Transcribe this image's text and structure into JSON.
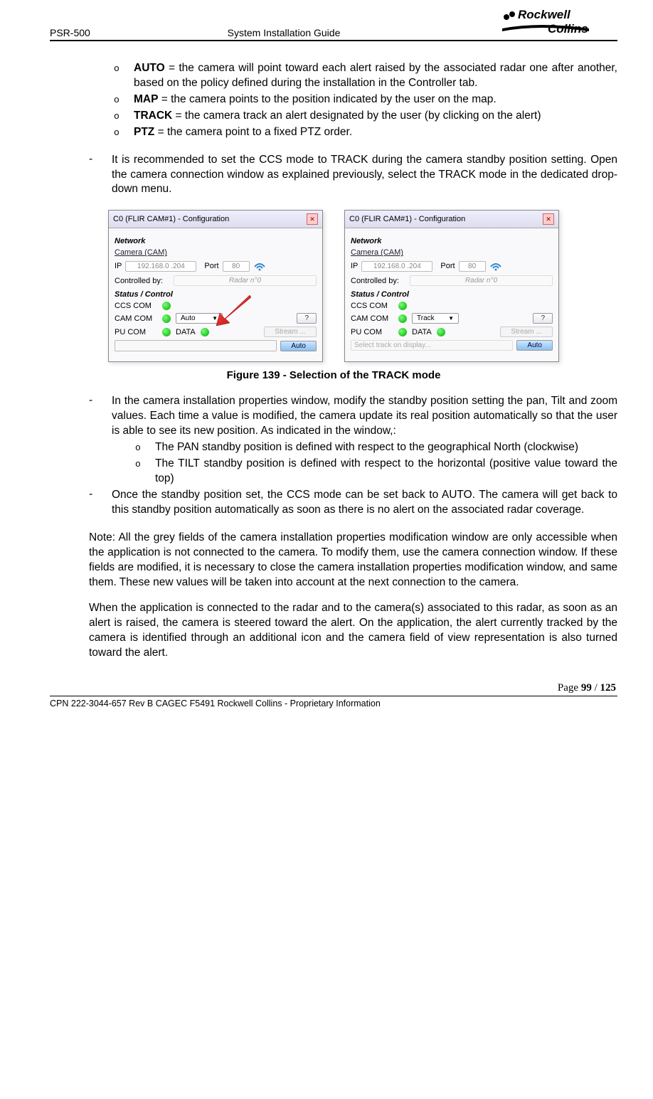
{
  "header": {
    "left": "PSR-500",
    "center": "System Installation Guide",
    "logo_top": "Rockwell",
    "logo_bottom": "Collins"
  },
  "definitions": [
    {
      "term": "AUTO",
      "text": " = the camera will point toward each alert raised by the associated radar one after another, based on the policy defined during the installation in the Controller tab."
    },
    {
      "term": " MAP",
      "text": " = the camera points to the position indicated by the user on the map."
    },
    {
      "term": "TRACK",
      "text": " = the camera track an alert designated by the user (by clicking on the alert)"
    },
    {
      "term": " PTZ",
      "text": " = the camera point to a fixed PTZ order."
    }
  ],
  "dash1": "It is recommended to set the CCS mode to TRACK during the camera standby position setting. Open the camera connection window as explained previously, select the TRACK mode in the dedicated drop-down menu.",
  "panel": {
    "title": "C0 (FLIR CAM#1) - Configuration",
    "network": "Network",
    "camera_link": "Camera (CAM)",
    "ip_label": "IP",
    "ip_value": "192.168.0 .204",
    "port_label": "Port",
    "port_value": "80",
    "controlled_by": "Controlled by:",
    "radar": "Radar n°0",
    "status": "Status / Control",
    "ccs": "CCS COM",
    "cam": "CAM COM",
    "pu": "PU COM",
    "data": "DATA",
    "combo_auto": "Auto",
    "combo_track": "Track",
    "q_btn": "?",
    "stream_btn": "Stream ...",
    "auto_btn": "Auto",
    "track_hint": "Select track on display..."
  },
  "figure_caption": "Figure 139 - Selection of the TRACK mode",
  "dash2_intro": "In the camera installation properties window, modify the standby position setting the pan, Tilt and zoom values. Each time a value is modified, the camera update its real position automatically so that the user is able to see its new position. As indicated in the window,:",
  "dash2_sub": [
    "The PAN standby position is defined with respect to the geographical North (clockwise)",
    "The TILT standby position is defined with respect to the horizontal (positive value toward the top)"
  ],
  "dash3": "Once the standby position set, the CCS mode can be set back to AUTO. The camera will get back to this standby position automatically as soon as there is no alert on the associated radar coverage.",
  "note": "Note: All the grey fields of the camera installation properties modification window are only accessible when the application is not connected to the camera. To modify them, use the camera connection window. If these fields are modified, it is necessary to close the camera installation properties modification window, and same them. These new values will be taken into account at the next connection to the camera.",
  "para_last": "When the application is connected to the radar and to the camera(s) associated to this radar, as soon as an alert is raised, the camera is steered toward the alert. On the application, the alert currently tracked by the camera is identified through an additional icon and the camera field of view representation is also turned toward the alert.",
  "footer": {
    "page_prefix": "Page ",
    "page_current": "99",
    "page_sep": " / ",
    "page_total": "125",
    "line": "CPN 222-3044-657 Rev B CAGEC F5491 Rockwell Collins - Proprietary Information"
  }
}
